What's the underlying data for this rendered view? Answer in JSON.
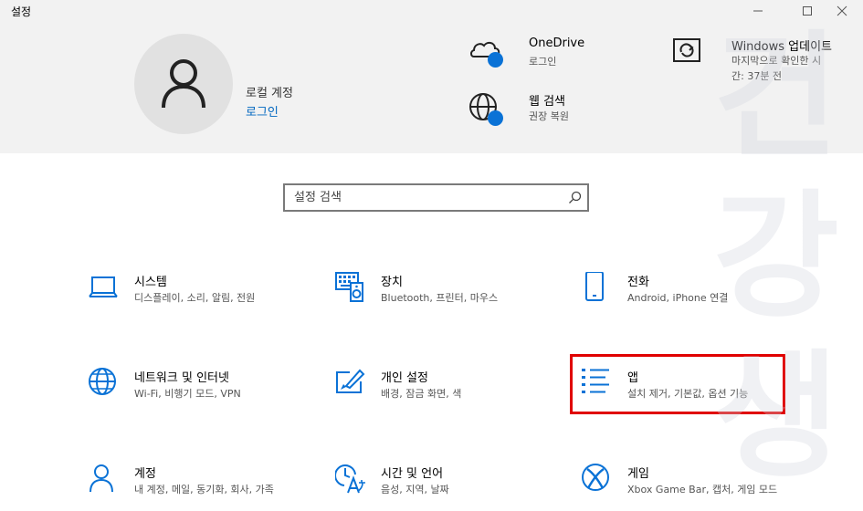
{
  "window": {
    "title": "설정"
  },
  "account": {
    "label": "로컬 계정",
    "link": "로그인"
  },
  "quick_links": [
    {
      "title": "OneDrive",
      "sub": "로그인"
    },
    {
      "title": "웹 검색",
      "sub": "권장 복원"
    },
    {
      "title": "Windows 업데이트",
      "sub1": "마지막으로 확인한 시",
      "sub2": "간: 37분 전"
    }
  ],
  "search": {
    "placeholder": "설정 검색"
  },
  "categories": [
    {
      "title": "시스템",
      "sub": "디스플레이, 소리, 알림, 전원"
    },
    {
      "title": "장치",
      "sub": "Bluetooth, 프린터, 마우스"
    },
    {
      "title": "전화",
      "sub": "Android, iPhone 연결"
    },
    {
      "title": "네트워크 및 인터넷",
      "sub": "Wi-Fi, 비행기 모드, VPN"
    },
    {
      "title": "개인 설정",
      "sub": "배경, 잠금 화면, 색"
    },
    {
      "title": "앱",
      "sub": "설치 제거, 기본값, 옵션 기능"
    },
    {
      "title": "계정",
      "sub": "내 계정, 메일, 동기화, 회사, 가족"
    },
    {
      "title": "시간 및 언어",
      "sub": "음성, 지역, 날짜"
    },
    {
      "title": "게임",
      "sub": "Xbox Game Bar, 캡처, 게임 모드"
    }
  ],
  "watermark": [
    "건",
    "강",
    "생"
  ],
  "colors": {
    "accent": "#0067c0",
    "icon_blue": "#0a72d6",
    "highlight": "#e00000",
    "header_bg": "#f2f2f2"
  }
}
